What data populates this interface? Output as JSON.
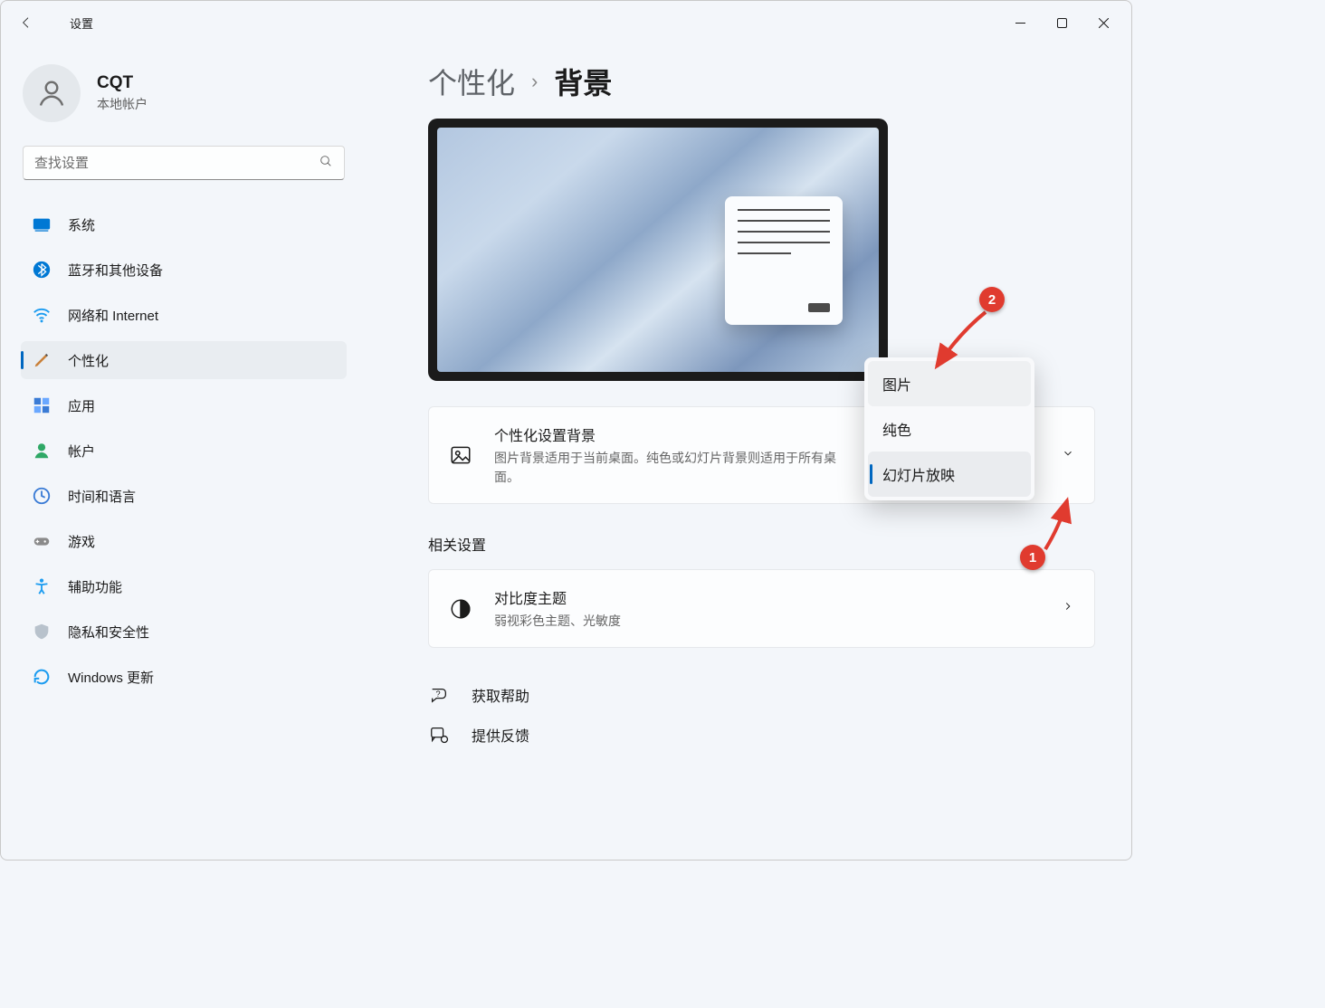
{
  "window": {
    "app_title": "设置"
  },
  "profile": {
    "name": "CQT",
    "type": "本地帐户"
  },
  "search": {
    "placeholder": "查找设置"
  },
  "nav": {
    "system": {
      "label": "系统"
    },
    "bluetooth": {
      "label": "蓝牙和其他设备"
    },
    "network": {
      "label": "网络和 Internet"
    },
    "personalize": {
      "label": "个性化"
    },
    "apps": {
      "label": "应用"
    },
    "accounts": {
      "label": "帐户"
    },
    "time": {
      "label": "时间和语言"
    },
    "gaming": {
      "label": "游戏"
    },
    "access": {
      "label": "辅助功能"
    },
    "privacy": {
      "label": "隐私和安全性"
    },
    "update": {
      "label": "Windows 更新"
    }
  },
  "breadcrumb": {
    "parent": "个性化",
    "current": "背景"
  },
  "bg_card": {
    "title": "个性化设置背景",
    "desc": "图片背景适用于当前桌面。纯色或幻灯片背景则适用于所有桌面。"
  },
  "dropdown": {
    "opt_picture": "图片",
    "opt_solid": "纯色",
    "opt_slideshow": "幻灯片放映"
  },
  "related": {
    "heading": "相关设置"
  },
  "contrast_card": {
    "title": "对比度主题",
    "desc": "弱视彩色主题、光敏度"
  },
  "links": {
    "help": "获取帮助",
    "feedback": "提供反馈"
  },
  "annotations": {
    "badge1": "1",
    "badge2": "2"
  }
}
